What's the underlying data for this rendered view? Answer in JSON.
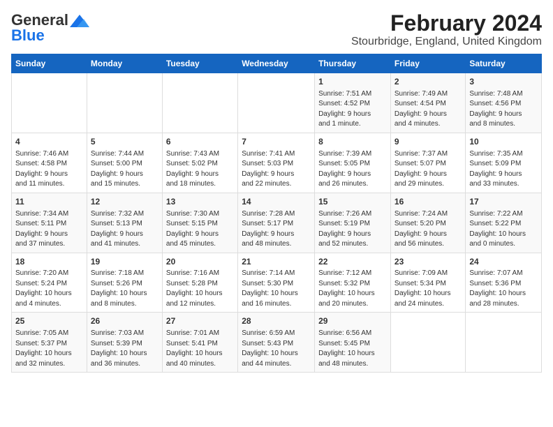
{
  "logo": {
    "general": "General",
    "blue": "Blue"
  },
  "title": "February 2024",
  "subtitle": "Stourbridge, England, United Kingdom",
  "headers": [
    "Sunday",
    "Monday",
    "Tuesday",
    "Wednesday",
    "Thursday",
    "Friday",
    "Saturday"
  ],
  "weeks": [
    [
      {
        "day": "",
        "info": ""
      },
      {
        "day": "",
        "info": ""
      },
      {
        "day": "",
        "info": ""
      },
      {
        "day": "",
        "info": ""
      },
      {
        "day": "1",
        "info": "Sunrise: 7:51 AM\nSunset: 4:52 PM\nDaylight: 9 hours\nand 1 minute."
      },
      {
        "day": "2",
        "info": "Sunrise: 7:49 AM\nSunset: 4:54 PM\nDaylight: 9 hours\nand 4 minutes."
      },
      {
        "day": "3",
        "info": "Sunrise: 7:48 AM\nSunset: 4:56 PM\nDaylight: 9 hours\nand 8 minutes."
      }
    ],
    [
      {
        "day": "4",
        "info": "Sunrise: 7:46 AM\nSunset: 4:58 PM\nDaylight: 9 hours\nand 11 minutes."
      },
      {
        "day": "5",
        "info": "Sunrise: 7:44 AM\nSunset: 5:00 PM\nDaylight: 9 hours\nand 15 minutes."
      },
      {
        "day": "6",
        "info": "Sunrise: 7:43 AM\nSunset: 5:02 PM\nDaylight: 9 hours\nand 18 minutes."
      },
      {
        "day": "7",
        "info": "Sunrise: 7:41 AM\nSunset: 5:03 PM\nDaylight: 9 hours\nand 22 minutes."
      },
      {
        "day": "8",
        "info": "Sunrise: 7:39 AM\nSunset: 5:05 PM\nDaylight: 9 hours\nand 26 minutes."
      },
      {
        "day": "9",
        "info": "Sunrise: 7:37 AM\nSunset: 5:07 PM\nDaylight: 9 hours\nand 29 minutes."
      },
      {
        "day": "10",
        "info": "Sunrise: 7:35 AM\nSunset: 5:09 PM\nDaylight: 9 hours\nand 33 minutes."
      }
    ],
    [
      {
        "day": "11",
        "info": "Sunrise: 7:34 AM\nSunset: 5:11 PM\nDaylight: 9 hours\nand 37 minutes."
      },
      {
        "day": "12",
        "info": "Sunrise: 7:32 AM\nSunset: 5:13 PM\nDaylight: 9 hours\nand 41 minutes."
      },
      {
        "day": "13",
        "info": "Sunrise: 7:30 AM\nSunset: 5:15 PM\nDaylight: 9 hours\nand 45 minutes."
      },
      {
        "day": "14",
        "info": "Sunrise: 7:28 AM\nSunset: 5:17 PM\nDaylight: 9 hours\nand 48 minutes."
      },
      {
        "day": "15",
        "info": "Sunrise: 7:26 AM\nSunset: 5:19 PM\nDaylight: 9 hours\nand 52 minutes."
      },
      {
        "day": "16",
        "info": "Sunrise: 7:24 AM\nSunset: 5:20 PM\nDaylight: 9 hours\nand 56 minutes."
      },
      {
        "day": "17",
        "info": "Sunrise: 7:22 AM\nSunset: 5:22 PM\nDaylight: 10 hours\nand 0 minutes."
      }
    ],
    [
      {
        "day": "18",
        "info": "Sunrise: 7:20 AM\nSunset: 5:24 PM\nDaylight: 10 hours\nand 4 minutes."
      },
      {
        "day": "19",
        "info": "Sunrise: 7:18 AM\nSunset: 5:26 PM\nDaylight: 10 hours\nand 8 minutes."
      },
      {
        "day": "20",
        "info": "Sunrise: 7:16 AM\nSunset: 5:28 PM\nDaylight: 10 hours\nand 12 minutes."
      },
      {
        "day": "21",
        "info": "Sunrise: 7:14 AM\nSunset: 5:30 PM\nDaylight: 10 hours\nand 16 minutes."
      },
      {
        "day": "22",
        "info": "Sunrise: 7:12 AM\nSunset: 5:32 PM\nDaylight: 10 hours\nand 20 minutes."
      },
      {
        "day": "23",
        "info": "Sunrise: 7:09 AM\nSunset: 5:34 PM\nDaylight: 10 hours\nand 24 minutes."
      },
      {
        "day": "24",
        "info": "Sunrise: 7:07 AM\nSunset: 5:36 PM\nDaylight: 10 hours\nand 28 minutes."
      }
    ],
    [
      {
        "day": "25",
        "info": "Sunrise: 7:05 AM\nSunset: 5:37 PM\nDaylight: 10 hours\nand 32 minutes."
      },
      {
        "day": "26",
        "info": "Sunrise: 7:03 AM\nSunset: 5:39 PM\nDaylight: 10 hours\nand 36 minutes."
      },
      {
        "day": "27",
        "info": "Sunrise: 7:01 AM\nSunset: 5:41 PM\nDaylight: 10 hours\nand 40 minutes."
      },
      {
        "day": "28",
        "info": "Sunrise: 6:59 AM\nSunset: 5:43 PM\nDaylight: 10 hours\nand 44 minutes."
      },
      {
        "day": "29",
        "info": "Sunrise: 6:56 AM\nSunset: 5:45 PM\nDaylight: 10 hours\nand 48 minutes."
      },
      {
        "day": "",
        "info": ""
      },
      {
        "day": "",
        "info": ""
      }
    ]
  ]
}
